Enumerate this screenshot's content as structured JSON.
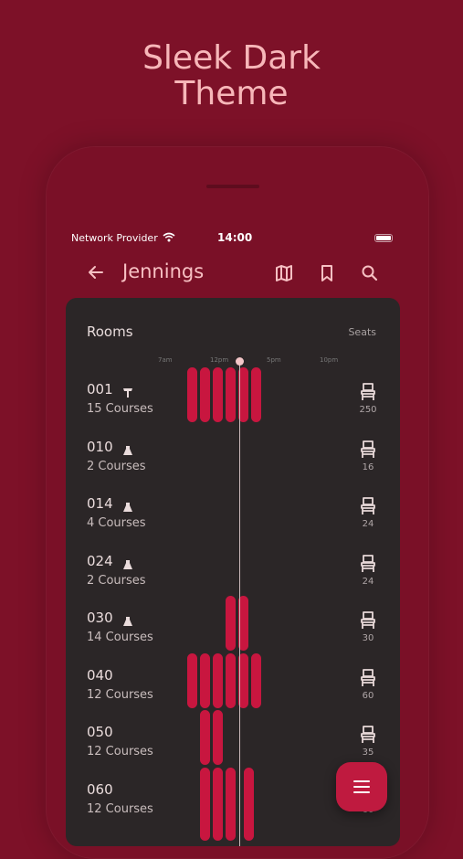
{
  "headline": {
    "line1": "Sleek Dark",
    "line2": "Theme"
  },
  "status_bar": {
    "carrier": "Network Provider",
    "time": "14:00"
  },
  "app_bar": {
    "title": "Jennings",
    "actions": [
      "map-icon",
      "bookmark-icon",
      "search-icon"
    ]
  },
  "schedule": {
    "rooms_header": "Rooms",
    "seats_header": "Seats",
    "time_ticks": [
      "7am",
      "12pm",
      "5pm",
      "10pm"
    ],
    "rooms": [
      {
        "name": "001",
        "type_icon": "lectern-icon",
        "courses": "15 Courses",
        "seats": "250"
      },
      {
        "name": "010",
        "type_icon": "flask-icon",
        "courses": "2 Courses",
        "seats": "16"
      },
      {
        "name": "014",
        "type_icon": "flask-icon",
        "courses": "4 Courses",
        "seats": "24"
      },
      {
        "name": "024",
        "type_icon": "flask-icon",
        "courses": "2 Courses",
        "seats": "24"
      },
      {
        "name": "030",
        "type_icon": "flask-icon",
        "courses": "14 Courses",
        "seats": "30"
      },
      {
        "name": "040",
        "type_icon": "",
        "courses": "12 Courses",
        "seats": "60"
      },
      {
        "name": "050",
        "type_icon": "",
        "courses": "12 Courses",
        "seats": "35"
      },
      {
        "name": "060",
        "type_icon": "",
        "courses": "12 Courses",
        "seats": "60"
      }
    ]
  },
  "fab": {
    "icon": "menu-icon"
  },
  "colors": {
    "background": "#7d1128",
    "card": "#2b2627",
    "accent": "#c8163f",
    "headline": "#f7b7b9"
  }
}
